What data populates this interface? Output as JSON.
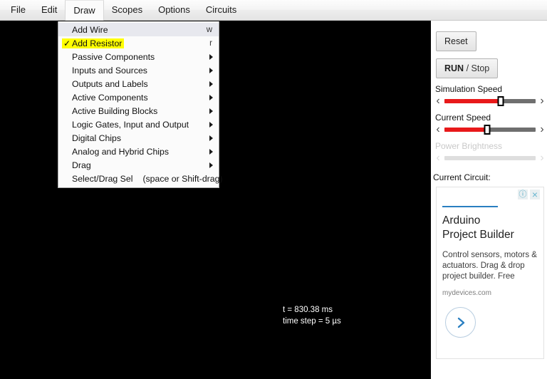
{
  "menubar": {
    "items": [
      {
        "label": "File",
        "active": false
      },
      {
        "label": "Edit",
        "active": false
      },
      {
        "label": "Draw",
        "active": true
      },
      {
        "label": "Scopes",
        "active": false
      },
      {
        "label": "Options",
        "active": false
      },
      {
        "label": "Circuits",
        "active": false
      }
    ]
  },
  "dropdown": {
    "owner": "Draw",
    "items": [
      {
        "label": "Add Wire",
        "shortcut": "w",
        "submenu": false,
        "checked": false,
        "row_highlight": true,
        "text_highlight": false,
        "hint": ""
      },
      {
        "label": "Add Resistor",
        "shortcut": "r",
        "submenu": false,
        "checked": true,
        "row_highlight": false,
        "text_highlight": true,
        "hint": ""
      },
      {
        "label": "Passive Components",
        "shortcut": "",
        "submenu": true,
        "checked": false,
        "row_highlight": false,
        "text_highlight": false,
        "hint": ""
      },
      {
        "label": "Inputs and Sources",
        "shortcut": "",
        "submenu": true,
        "checked": false,
        "row_highlight": false,
        "text_highlight": false,
        "hint": ""
      },
      {
        "label": "Outputs and Labels",
        "shortcut": "",
        "submenu": true,
        "checked": false,
        "row_highlight": false,
        "text_highlight": false,
        "hint": ""
      },
      {
        "label": "Active Components",
        "shortcut": "",
        "submenu": true,
        "checked": false,
        "row_highlight": false,
        "text_highlight": false,
        "hint": ""
      },
      {
        "label": "Active Building Blocks",
        "shortcut": "",
        "submenu": true,
        "checked": false,
        "row_highlight": false,
        "text_highlight": false,
        "hint": ""
      },
      {
        "label": "Logic Gates, Input and Output",
        "shortcut": "",
        "submenu": true,
        "checked": false,
        "row_highlight": false,
        "text_highlight": false,
        "hint": ""
      },
      {
        "label": "Digital Chips",
        "shortcut": "",
        "submenu": true,
        "checked": false,
        "row_highlight": false,
        "text_highlight": false,
        "hint": ""
      },
      {
        "label": "Analog and Hybrid Chips",
        "shortcut": "",
        "submenu": true,
        "checked": false,
        "row_highlight": false,
        "text_highlight": false,
        "hint": ""
      },
      {
        "label": "Drag",
        "shortcut": "",
        "submenu": true,
        "checked": false,
        "row_highlight": false,
        "text_highlight": false,
        "hint": ""
      },
      {
        "label": "Select/Drag Sel",
        "shortcut": "",
        "submenu": false,
        "checked": false,
        "row_highlight": false,
        "text_highlight": false,
        "hint": "(space or Shift-drag)"
      }
    ],
    "check_glyph": "✓"
  },
  "canvas": {
    "background_color": "#000000",
    "sim_time": "t = 830.38 ms",
    "time_step": "time step = 5 µs"
  },
  "sidebar": {
    "reset_label": "Reset",
    "run_label_strong": "RUN",
    "run_label_rest": " / Stop",
    "sliders": [
      {
        "label": "Simulation Speed",
        "value_percent": 62,
        "disabled": false,
        "fill_color": "#e8191a",
        "track_color": "#6f6f6f"
      },
      {
        "label": "Current Speed",
        "value_percent": 47,
        "disabled": false,
        "fill_color": "#e8191a",
        "track_color": "#6f6f6f"
      },
      {
        "label": "Power Brightness",
        "value_percent": 0,
        "disabled": true,
        "fill_color": "#e8191a",
        "track_color": "#dedede"
      }
    ],
    "left_chevron": "‹",
    "right_chevron": "›",
    "current_circuit_label": "Current Circuit:"
  },
  "ad": {
    "info_glyph": "ⓘ",
    "close_glyph": "×",
    "title": "Arduino\nProject Builder",
    "body": "Control sensors, motors & actuators. Drag & drop project builder. Free",
    "domain": "mydevices.com",
    "accent_color": "#2a7fc1"
  }
}
